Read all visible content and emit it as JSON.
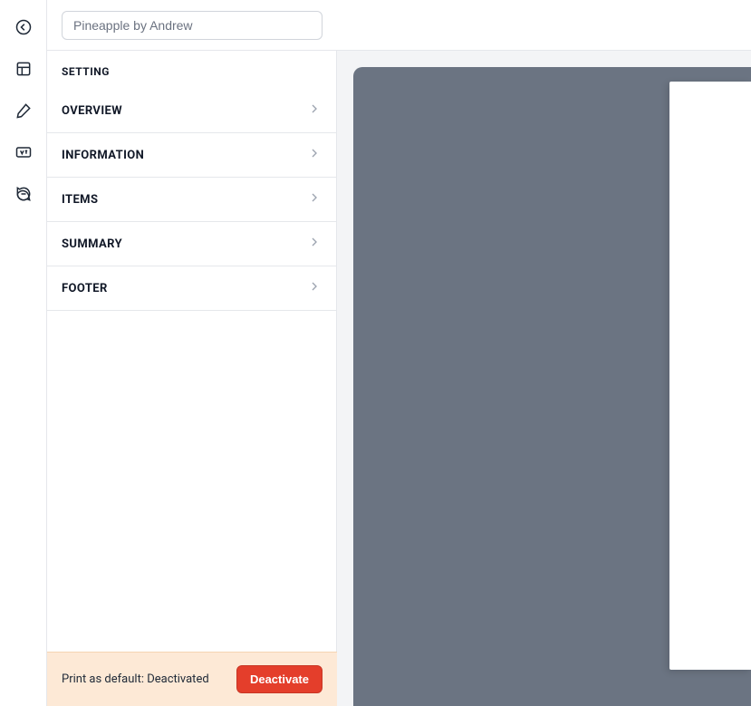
{
  "header": {
    "title_value": "Pineapple by Andrew"
  },
  "sidebar": {
    "heading": "SETTING",
    "items": [
      {
        "label": "OVERVIEW"
      },
      {
        "label": "INFORMATION"
      },
      {
        "label": "ITEMS"
      },
      {
        "label": "SUMMARY"
      },
      {
        "label": "FOOTER"
      }
    ]
  },
  "footer": {
    "status_text": "Print as default: Deactivated",
    "button_label": "Deactivate"
  }
}
